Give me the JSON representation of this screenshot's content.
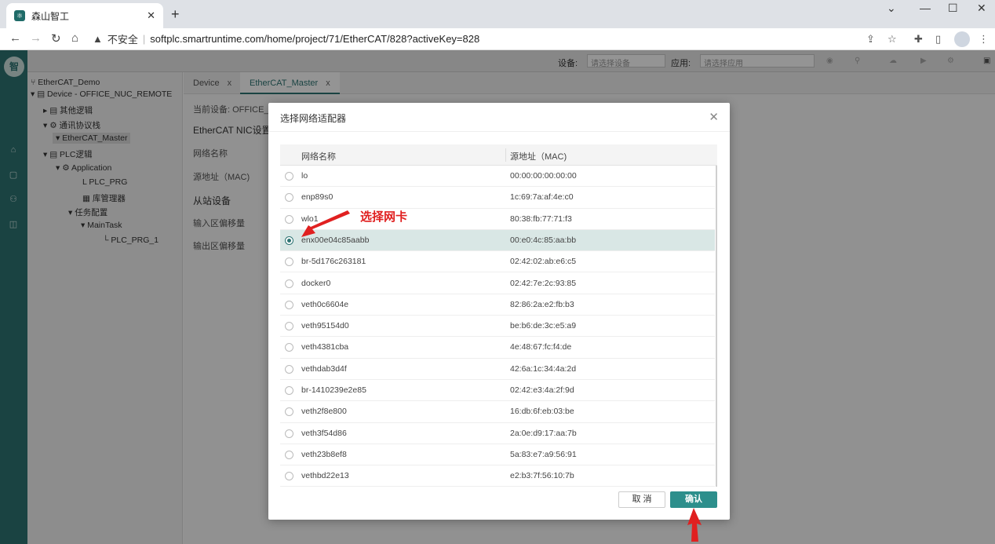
{
  "browser": {
    "tab_title": "森山智工",
    "tab_favicon": "⚛",
    "security_label": "不安全",
    "url": "softplc.smartruntime.com/home/project/71/EtherCAT/828?activeKey=828"
  },
  "rail": {
    "logo_text": "智"
  },
  "toolbar": {
    "device_label": "设备:",
    "device_placeholder": "请选择设备",
    "app_label": "应用:",
    "app_placeholder": "请选择应用"
  },
  "tree": {
    "root": "EtherCAT_Demo",
    "device": "Device - OFFICE_NUC_REMOTE",
    "other_logic": "其他逻辑",
    "comm_bus": "通讯协议栈",
    "ethercat_master": "EtherCAT_Master",
    "plc_logic": "PLC逻辑",
    "application": "Application",
    "plc_prg": "PLC_PRG",
    "library_manager": "库管理器",
    "task_config": "任务配置",
    "main_task": "MainTask",
    "plc_prg_1": "PLC_PRG_1"
  },
  "content": {
    "tab_device": "Device",
    "tab_ethercat": "EtherCAT_Master",
    "current_device": "当前设备: OFFICE_NU",
    "nic_settings": "EtherCAT NIC设置",
    "network_name": "网络名称",
    "source_address": "源地址（MAC)",
    "slave_devices": "从站设备",
    "input_offset": "输入区偏移量",
    "output_offset": "输出区偏移量"
  },
  "dialog": {
    "title": "选择网络适配器",
    "col_name": "网络名称",
    "col_mac": "源地址（MAC)",
    "rows": [
      {
        "name": "lo",
        "mac": "00:00:00:00:00:00"
      },
      {
        "name": "enp89s0",
        "mac": "1c:69:7a:af:4e:c0"
      },
      {
        "name": "wlo1",
        "mac": "80:38:fb:77:71:f3"
      },
      {
        "name": "enx00e04c85aabb",
        "mac": "00:e0:4c:85:aa:bb"
      },
      {
        "name": "br-5d176c263181",
        "mac": "02:42:02:ab:e6:c5"
      },
      {
        "name": "docker0",
        "mac": "02:42:7e:2c:93:85"
      },
      {
        "name": "veth0c6604e",
        "mac": "82:86:2a:e2:fb:b3"
      },
      {
        "name": "veth95154d0",
        "mac": "be:b6:de:3c:e5:a9"
      },
      {
        "name": "veth4381cba",
        "mac": "4e:48:67:fc:f4:de"
      },
      {
        "name": "vethdab3d4f",
        "mac": "42:6a:1c:34:4a:2d"
      },
      {
        "name": "br-1410239e2e85",
        "mac": "02:42:e3:4a:2f:9d"
      },
      {
        "name": "veth2f8e800",
        "mac": "16:db:6f:eb:03:be"
      },
      {
        "name": "veth3f54d86",
        "mac": "2a:0e:d9:17:aa:7b"
      },
      {
        "name": "veth23b8ef8",
        "mac": "5a:83:e7:a9:56:91"
      },
      {
        "name": "vethbd22e13",
        "mac": "e2:b3:7f:56:10:7b"
      }
    ],
    "selected_index": 3,
    "cancel_label": "取 消",
    "ok_label": "确认"
  },
  "annotation": {
    "text": "选择网卡",
    "color": "#e02020"
  },
  "colors": {
    "accent": "#2d7473",
    "button": "#2d8f8c"
  }
}
